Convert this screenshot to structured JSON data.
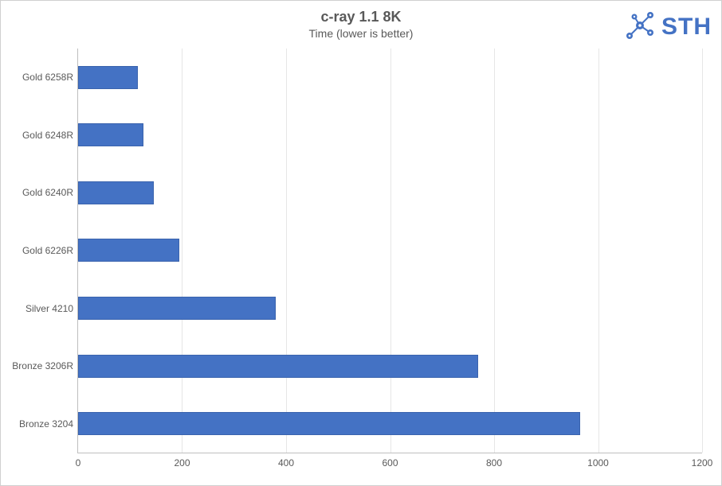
{
  "chart_data": {
    "type": "bar",
    "orientation": "horizontal",
    "title": "c-ray 1.1 8K",
    "subtitle": "Time (lower is better)",
    "xlabel": "",
    "ylabel": "",
    "xlim": [
      0,
      1200
    ],
    "x_ticks": [
      0,
      200,
      400,
      600,
      800,
      1000,
      1200
    ],
    "categories": [
      "Gold 6258R",
      "Gold 6248R",
      "Gold 6240R",
      "Gold 6226R",
      "Silver 4210",
      "Bronze 3206R",
      "Bronze 3204"
    ],
    "values": [
      115,
      125,
      145,
      195,
      380,
      770,
      965
    ],
    "bar_color": "#4472c4",
    "grid_x": true
  },
  "logo": {
    "text": "STH",
    "icon_name": "network-nodes-icon"
  }
}
